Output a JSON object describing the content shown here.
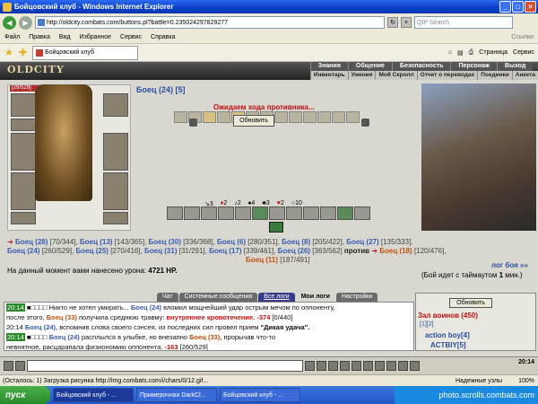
{
  "window": {
    "title": "Бойцовский клуб - Windows Internet Explorer"
  },
  "browser": {
    "url": "http://oldcity.combats.com/buttons.pl?battle=0.235024297829277",
    "search_placeholder": "QIP Search",
    "menu": [
      "Файл",
      "Правка",
      "Вид",
      "Избранное",
      "Сервис",
      "Справка"
    ],
    "links_label": "Ссылки",
    "tab_label": "Бойцовский клуб",
    "page_label": "Страница",
    "tools_label": "Сервис"
  },
  "game": {
    "logo": "OLDCITY",
    "nav_top": [
      "Знания",
      "Общение",
      "Безопасность",
      "Персонаж",
      "Выход"
    ],
    "nav_bottom": [
      "Инвентарь",
      "Умения",
      "Мой Скролл",
      "Отчет о переводах",
      "Поединки",
      "Анкета"
    ],
    "hp": "[29/529]",
    "fighter_name": "Боец (24)",
    "fighter_flags": "[5]",
    "waiting": "Ожидаем хода противника...",
    "refresh_label": "Обновить",
    "stats": [
      "3",
      "2",
      "2",
      "4",
      "3",
      "2",
      "10"
    ],
    "fightline1_a": "Боец (28)",
    "fightline1_b": "[70/344],",
    "fightline1_c": "Боец (13)",
    "fightline1_d": "[143/365],",
    "fightline1_e": "Боец (30)",
    "fightline1_f": "[336/368],",
    "fightline1_g": "Боец (6)",
    "fightline1_h": "[280/351],",
    "fightline1_i": "Боец (8)",
    "fightline1_j": "[205/422],",
    "fightline1_k": "Боец (27)",
    "fightline1_l": "[135/333],",
    "fightline2_a": "Боец (24)",
    "fightline2_b": "[260/529],",
    "fightline2_c": "Боец (25)",
    "fightline2_d": "[270/416],",
    "fightline2_e": "Боец (31)",
    "fightline2_f": "[31/291],",
    "fightline2_g": "Боец (17)",
    "fightline2_h": "[339/461],",
    "fightline2_i": "Боец (26)",
    "fightline2_j": "[363/562]",
    "fightline2_vs": "против",
    "fightline2_k": "Боец (18)",
    "fightline2_l": "[120/476],",
    "fightline3_a": "Боец",
    "fightline3_b": "(11)",
    "fightline3_c": "[187/491]",
    "damage_text": "На данный момент вами нанесено урона:",
    "damage_value": "4721 HP.",
    "log_button": "лог боя »»",
    "timeout_note_a": "(Бой идет с таймаутом",
    "timeout_note_b": "1",
    "timeout_note_c": "мин.)",
    "tabs": [
      "Чат",
      "Системные сообщения",
      "Все логи",
      "Мои логи",
      "Настройки"
    ],
    "chat": {
      "l1_time": "20:14",
      "l1_a": "Никто не хотел умирать...",
      "l1_b": "Боец (24)",
      "l1_c": "вломил мощнейший удар острым мечом по оппоненту,",
      "l2_a": "после этого,",
      "l2_b": "Боец (33)",
      "l2_c": "получила среднюю травму:",
      "l2_d": "внутреннее кровотечение.",
      "l2_e": "-374",
      "l2_f": "[0/440]",
      "l3_time": "20:14",
      "l3_a": "Боец (24),",
      "l3_b": "вспомнив слова своего сэнсея, из последних сил провел прием",
      "l3_c": "\"Дикая удача\".",
      "l4_time": "20:14",
      "l4_a": "Боец (24)",
      "l4_b": "расплылся в улыбке, но внезапно",
      "l4_c": "Боец (33),",
      "l4_d": "прорычав что-то",
      "l5_a": "невнятное, расцарапала физиономию оппонента.",
      "l5_b": "-163",
      "l5_c": "[260/529]"
    },
    "side": {
      "refresh": "Обновить",
      "hall": "Зал воинов (450)",
      "pages": "[1][2]",
      "user1": "action boy[4]",
      "user2": "ACTBIY[5]"
    },
    "clock": "20:14"
  },
  "statusbar": {
    "text": "(Осталось: 1) Загрузка рисунка http://img.combats.com/i/chars/0/12.gif...",
    "security": "Надежные узлы",
    "zoom": "100%"
  },
  "taskbar": {
    "start": "пуск",
    "tasks": [
      "Бойцовский клуб - ...",
      "Примерочная DarkCl...",
      "Бойцовский клуб - ..."
    ],
    "tray": "photo.scrolls.combats.com"
  }
}
